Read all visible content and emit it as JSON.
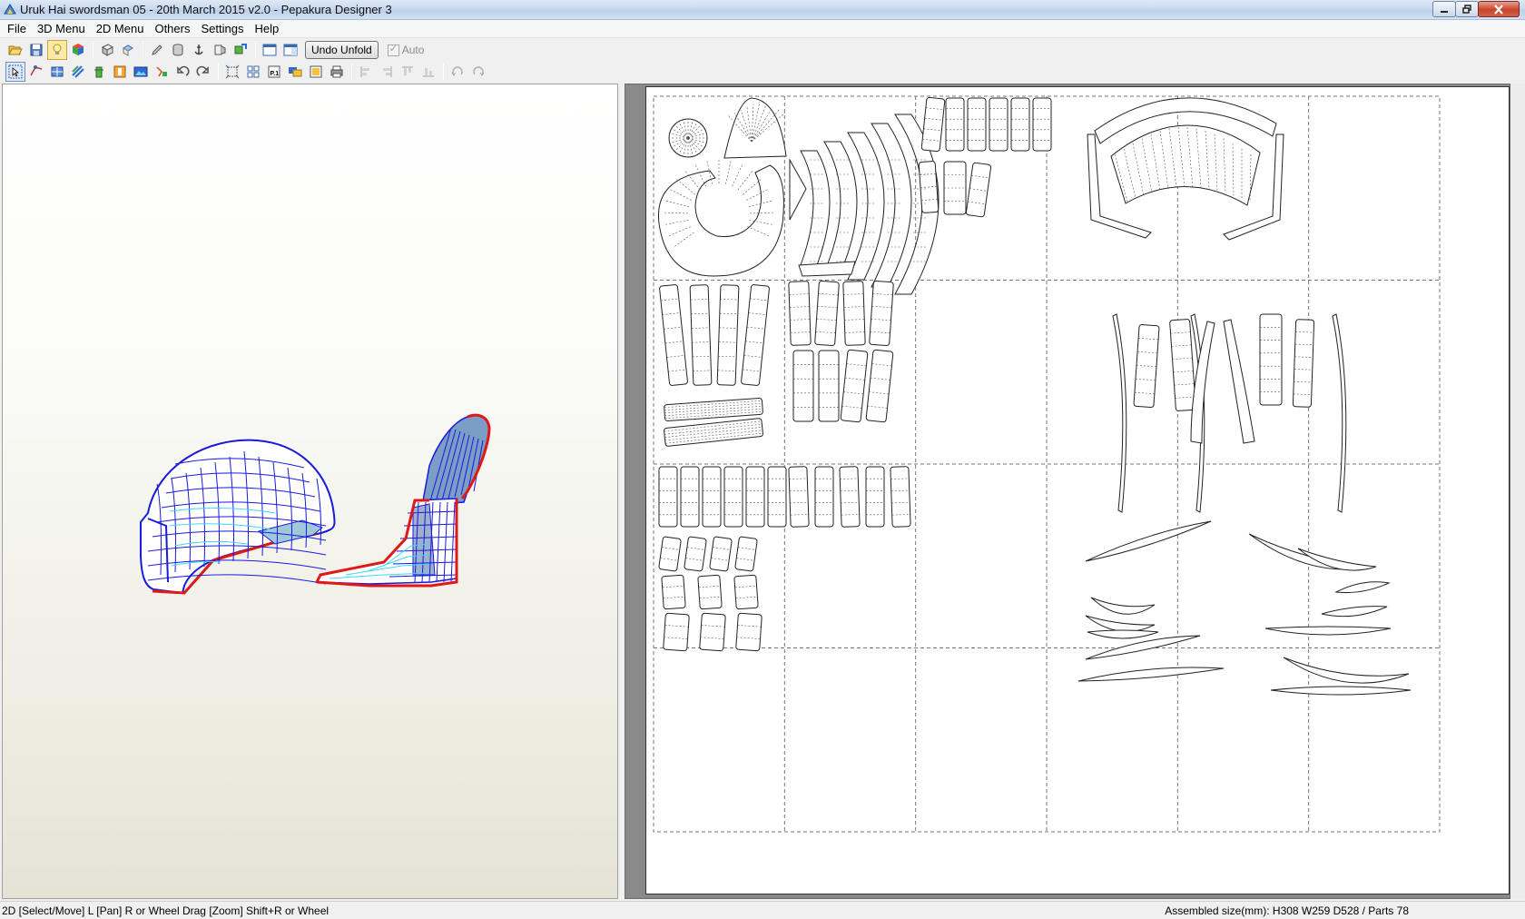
{
  "window": {
    "title": "Uruk Hai swordsman 05 - 20th March 2015 v2.0 - Pepakura Designer 3",
    "app_icon": "pepakura-icon"
  },
  "menu": {
    "items": [
      "File",
      "3D Menu",
      "2D Menu",
      "Others",
      "Settings",
      "Help"
    ]
  },
  "toolbar1": {
    "undo_unfold_label": "Undo Unfold",
    "auto_label": "Auto",
    "auto_checked": true
  },
  "status": {
    "left": "2D [Select/Move] L [Pan] R or Wheel Drag [Zoom] Shift+R or Wheel",
    "right": "Assembled size(mm): H308 W259 D528 / Parts 78"
  },
  "colors": {
    "mesh_edge": "#1a1adc",
    "mesh_fill": "#3ad8ff",
    "cut_edge": "#e01818"
  }
}
